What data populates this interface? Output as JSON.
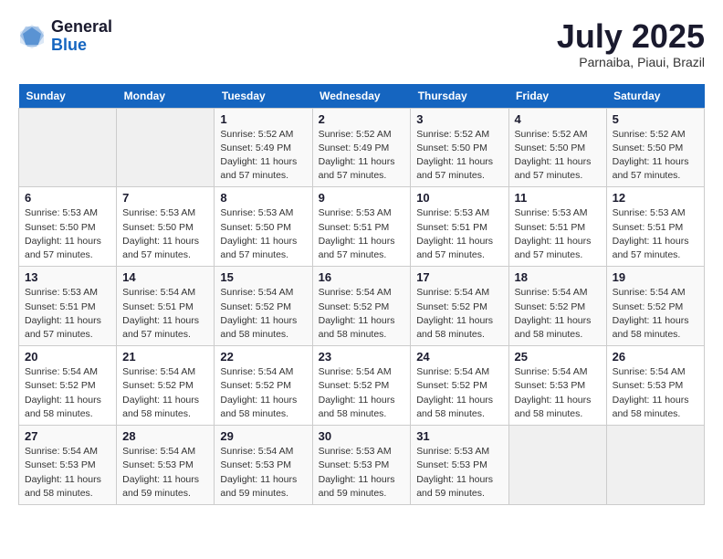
{
  "logo": {
    "general": "General",
    "blue": "Blue"
  },
  "title": "July 2025",
  "location": "Parnaiba, Piaui, Brazil",
  "days_of_week": [
    "Sunday",
    "Monday",
    "Tuesday",
    "Wednesday",
    "Thursday",
    "Friday",
    "Saturday"
  ],
  "weeks": [
    [
      {
        "day": "",
        "info": ""
      },
      {
        "day": "",
        "info": ""
      },
      {
        "day": "1",
        "info": "Sunrise: 5:52 AM\nSunset: 5:49 PM\nDaylight: 11 hours and 57 minutes."
      },
      {
        "day": "2",
        "info": "Sunrise: 5:52 AM\nSunset: 5:49 PM\nDaylight: 11 hours and 57 minutes."
      },
      {
        "day": "3",
        "info": "Sunrise: 5:52 AM\nSunset: 5:50 PM\nDaylight: 11 hours and 57 minutes."
      },
      {
        "day": "4",
        "info": "Sunrise: 5:52 AM\nSunset: 5:50 PM\nDaylight: 11 hours and 57 minutes."
      },
      {
        "day": "5",
        "info": "Sunrise: 5:52 AM\nSunset: 5:50 PM\nDaylight: 11 hours and 57 minutes."
      }
    ],
    [
      {
        "day": "6",
        "info": "Sunrise: 5:53 AM\nSunset: 5:50 PM\nDaylight: 11 hours and 57 minutes."
      },
      {
        "day": "7",
        "info": "Sunrise: 5:53 AM\nSunset: 5:50 PM\nDaylight: 11 hours and 57 minutes."
      },
      {
        "day": "8",
        "info": "Sunrise: 5:53 AM\nSunset: 5:50 PM\nDaylight: 11 hours and 57 minutes."
      },
      {
        "day": "9",
        "info": "Sunrise: 5:53 AM\nSunset: 5:51 PM\nDaylight: 11 hours and 57 minutes."
      },
      {
        "day": "10",
        "info": "Sunrise: 5:53 AM\nSunset: 5:51 PM\nDaylight: 11 hours and 57 minutes."
      },
      {
        "day": "11",
        "info": "Sunrise: 5:53 AM\nSunset: 5:51 PM\nDaylight: 11 hours and 57 minutes."
      },
      {
        "day": "12",
        "info": "Sunrise: 5:53 AM\nSunset: 5:51 PM\nDaylight: 11 hours and 57 minutes."
      }
    ],
    [
      {
        "day": "13",
        "info": "Sunrise: 5:53 AM\nSunset: 5:51 PM\nDaylight: 11 hours and 57 minutes."
      },
      {
        "day": "14",
        "info": "Sunrise: 5:54 AM\nSunset: 5:51 PM\nDaylight: 11 hours and 57 minutes."
      },
      {
        "day": "15",
        "info": "Sunrise: 5:54 AM\nSunset: 5:52 PM\nDaylight: 11 hours and 58 minutes."
      },
      {
        "day": "16",
        "info": "Sunrise: 5:54 AM\nSunset: 5:52 PM\nDaylight: 11 hours and 58 minutes."
      },
      {
        "day": "17",
        "info": "Sunrise: 5:54 AM\nSunset: 5:52 PM\nDaylight: 11 hours and 58 minutes."
      },
      {
        "day": "18",
        "info": "Sunrise: 5:54 AM\nSunset: 5:52 PM\nDaylight: 11 hours and 58 minutes."
      },
      {
        "day": "19",
        "info": "Sunrise: 5:54 AM\nSunset: 5:52 PM\nDaylight: 11 hours and 58 minutes."
      }
    ],
    [
      {
        "day": "20",
        "info": "Sunrise: 5:54 AM\nSunset: 5:52 PM\nDaylight: 11 hours and 58 minutes."
      },
      {
        "day": "21",
        "info": "Sunrise: 5:54 AM\nSunset: 5:52 PM\nDaylight: 11 hours and 58 minutes."
      },
      {
        "day": "22",
        "info": "Sunrise: 5:54 AM\nSunset: 5:52 PM\nDaylight: 11 hours and 58 minutes."
      },
      {
        "day": "23",
        "info": "Sunrise: 5:54 AM\nSunset: 5:52 PM\nDaylight: 11 hours and 58 minutes."
      },
      {
        "day": "24",
        "info": "Sunrise: 5:54 AM\nSunset: 5:52 PM\nDaylight: 11 hours and 58 minutes."
      },
      {
        "day": "25",
        "info": "Sunrise: 5:54 AM\nSunset: 5:53 PM\nDaylight: 11 hours and 58 minutes."
      },
      {
        "day": "26",
        "info": "Sunrise: 5:54 AM\nSunset: 5:53 PM\nDaylight: 11 hours and 58 minutes."
      }
    ],
    [
      {
        "day": "27",
        "info": "Sunrise: 5:54 AM\nSunset: 5:53 PM\nDaylight: 11 hours and 58 minutes."
      },
      {
        "day": "28",
        "info": "Sunrise: 5:54 AM\nSunset: 5:53 PM\nDaylight: 11 hours and 59 minutes."
      },
      {
        "day": "29",
        "info": "Sunrise: 5:54 AM\nSunset: 5:53 PM\nDaylight: 11 hours and 59 minutes."
      },
      {
        "day": "30",
        "info": "Sunrise: 5:53 AM\nSunset: 5:53 PM\nDaylight: 11 hours and 59 minutes."
      },
      {
        "day": "31",
        "info": "Sunrise: 5:53 AM\nSunset: 5:53 PM\nDaylight: 11 hours and 59 minutes."
      },
      {
        "day": "",
        "info": ""
      },
      {
        "day": "",
        "info": ""
      }
    ]
  ]
}
